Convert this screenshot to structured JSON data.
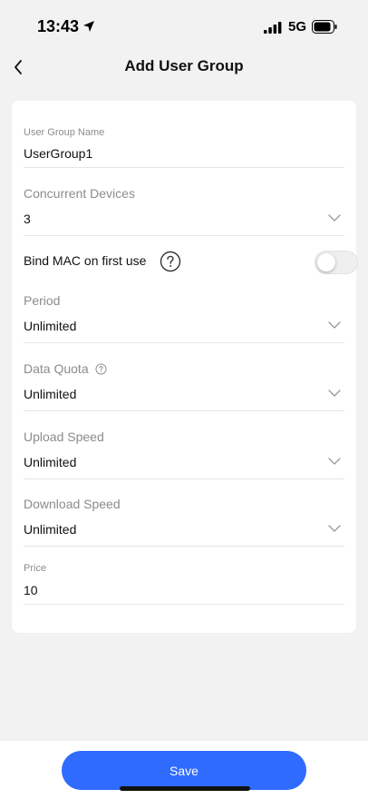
{
  "status_bar": {
    "time": "13:43",
    "network": "5G",
    "icons": [
      "location-arrow-icon",
      "signal-bars-icon",
      "battery-icon"
    ]
  },
  "nav": {
    "title": "Add User Group",
    "back_icon": "chevron-left-icon"
  },
  "form": {
    "user_group_name": {
      "label": "User Group Name",
      "value": "UserGroup1"
    },
    "concurrent_devices": {
      "label": "Concurrent Devices",
      "value": "3"
    },
    "bind_mac": {
      "label": "Bind MAC on first use",
      "enabled": false
    },
    "period": {
      "label": "Period",
      "value": "Unlimited"
    },
    "data_quota": {
      "label": "Data Quota",
      "value": "Unlimited"
    },
    "upload_speed": {
      "label": "Upload Speed",
      "value": "Unlimited"
    },
    "download_speed": {
      "label": "Download Speed",
      "value": "Unlimited"
    },
    "price": {
      "label": "Price",
      "value": "10"
    }
  },
  "footer": {
    "save_label": "Save"
  },
  "colors": {
    "accent": "#2f6bff",
    "background": "#f2f2f2",
    "card": "#ffffff"
  }
}
